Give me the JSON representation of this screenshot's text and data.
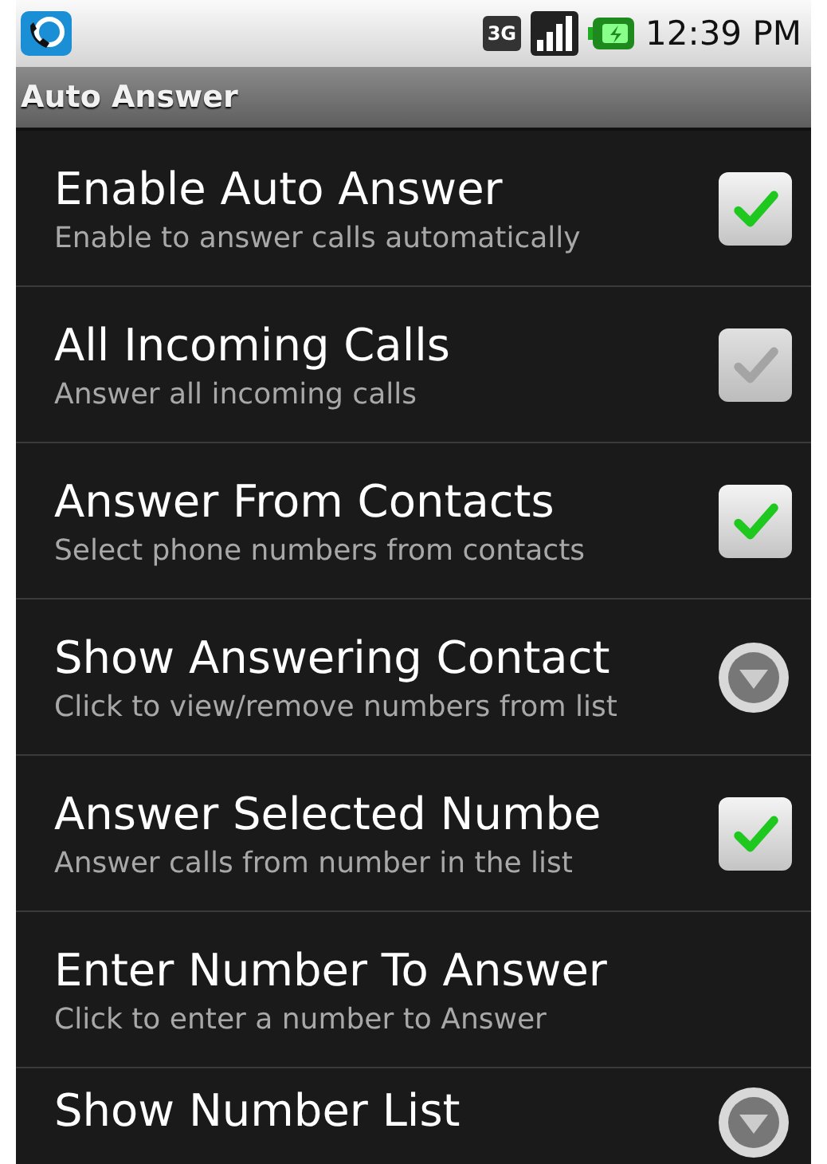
{
  "status_bar": {
    "time": "12:39 PM",
    "network": "3G"
  },
  "title_bar": {
    "title": "Auto Answer"
  },
  "preferences": [
    {
      "title": "Enable Auto Answer",
      "summary": "Enable to answer calls automatically",
      "kind": "checkbox",
      "checked": true,
      "disabled": false
    },
    {
      "title": "All Incoming Calls",
      "summary": "Answer all incoming calls",
      "kind": "checkbox",
      "checked": true,
      "disabled": true
    },
    {
      "title": "Answer From Contacts",
      "summary": "Select phone numbers from contacts",
      "kind": "checkbox",
      "checked": true,
      "disabled": false
    },
    {
      "title": "Show Answering Contact",
      "summary": "Click to view/remove numbers from list",
      "kind": "list"
    },
    {
      "title": "Answer Selected Numbe",
      "summary": "Answer calls from number in the list",
      "kind": "checkbox",
      "checked": true,
      "disabled": false
    },
    {
      "title": "Enter Number To Answer",
      "summary": "Click to enter a number to Answer",
      "kind": "plain"
    },
    {
      "title": "Show Number List",
      "kind": "list"
    }
  ]
}
